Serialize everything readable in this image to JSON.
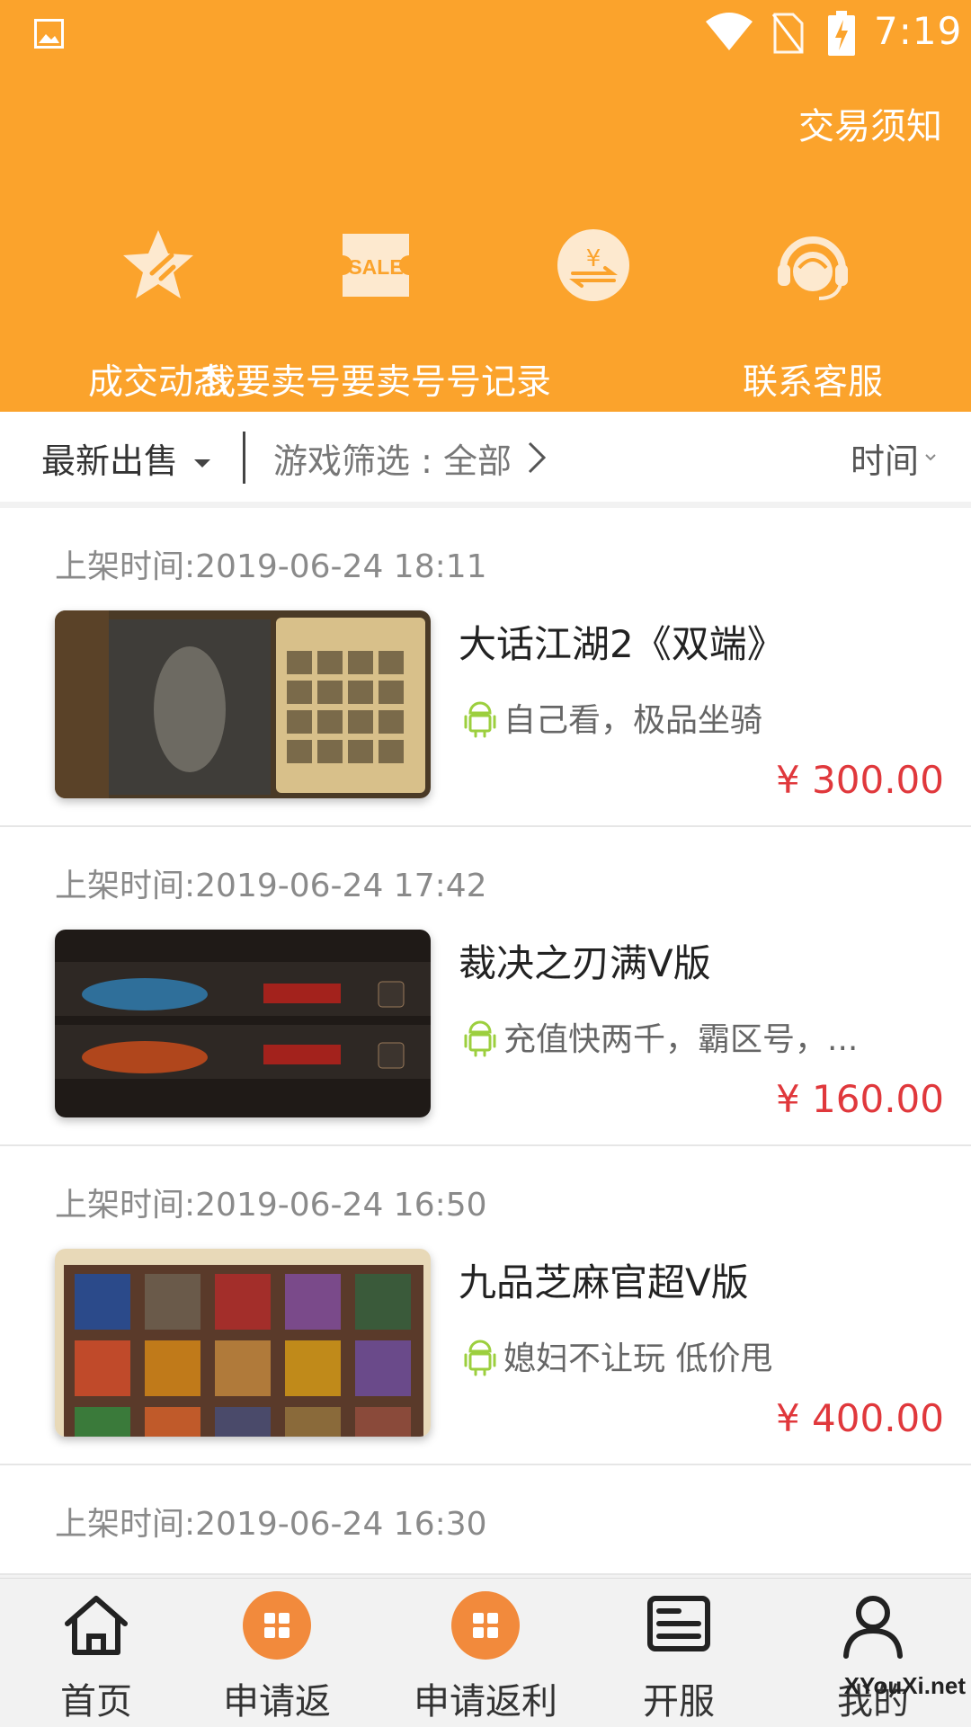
{
  "status_bar": {
    "time": "7:19"
  },
  "header": {
    "notice_link": "交易须知",
    "quick_actions": [
      {
        "label": "成交动态",
        "icon": "star-icon"
      },
      {
        "label": "我要卖号要卖号号记录",
        "icon": "sale-ticket-icon"
      },
      {
        "label": "",
        "icon": "yen-exchange-icon"
      },
      {
        "label": "联系客服",
        "icon": "headset-icon"
      }
    ]
  },
  "filter": {
    "latest": "最新出售",
    "game_filter": "游戏筛选 : 全部",
    "sort": "时间"
  },
  "listings": [
    {
      "date": "上架时间:2019-06-24 18:11",
      "title": "大话江湖2《双端》",
      "desc": "自己看，极品坐骑",
      "price": "¥ 300.00"
    },
    {
      "date": "上架时间:2019-06-24 17:42",
      "title": "裁决之刃满V版",
      "desc": "充值快两千，霸区号，...",
      "price": "¥ 160.00"
    },
    {
      "date": "上架时间:2019-06-24 16:50",
      "title": "九品芝麻官超V版",
      "desc": "媳妇不让玩 低价甩",
      "price": "¥ 400.00"
    },
    {
      "date": "上架时间:2019-06-24 16:30"
    }
  ],
  "bottom_nav": [
    {
      "label": "首页",
      "icon": "home-icon"
    },
    {
      "label": "申请返",
      "icon": "grid-icon"
    },
    {
      "label": "申请返利",
      "icon": "grid-icon"
    },
    {
      "label": "开服",
      "icon": "server-icon"
    },
    {
      "label": "我的",
      "icon": "user-icon"
    }
  ],
  "watermark": "XYouXi.net",
  "colors": {
    "primary": "#fba32c",
    "price": "#e0383c",
    "nav_accent": "#f28a3c",
    "android_green": "#9ccf3e"
  }
}
